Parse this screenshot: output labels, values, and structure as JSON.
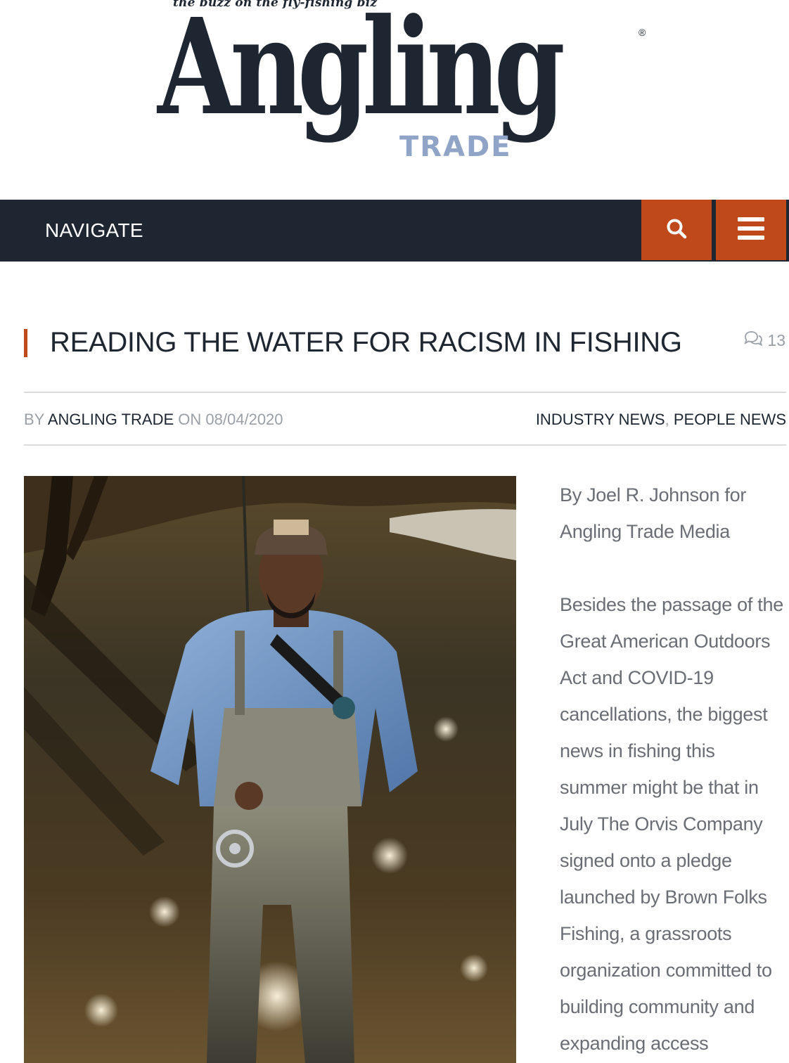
{
  "header": {
    "tagline": "the buzz on the fly-fishing biz",
    "logo_word": "Angling",
    "logo_sub": "TRADE",
    "registered_mark": "®"
  },
  "nav": {
    "label": "NAVIGATE",
    "search_icon": "search-icon",
    "menu_icon": "hamburger-menu-icon",
    "accent_color": "#c0491c",
    "bar_color": "#1e2631"
  },
  "article": {
    "title": "READING THE WATER FOR RACISM IN FISHING",
    "comment_count": "13",
    "by_label": "BY",
    "author": "ANGLING TRADE",
    "on_label": "ON",
    "date": "08/04/2020",
    "categories": [
      "INDUSTRY NEWS",
      "PEOPLE NEWS"
    ],
    "category_separator": ",",
    "byline": "By Joel R. Johnson for Angling Trade Media",
    "paragraph_1": "Besides the passage of the Great American Outdoors Act and COVID-19 cancellations, the biggest news in fishing this summer might be that in July The Orvis Company signed onto a pledge launched by Brown Folks Fishing, a grassroots organization committed to building community and expanding access"
  }
}
